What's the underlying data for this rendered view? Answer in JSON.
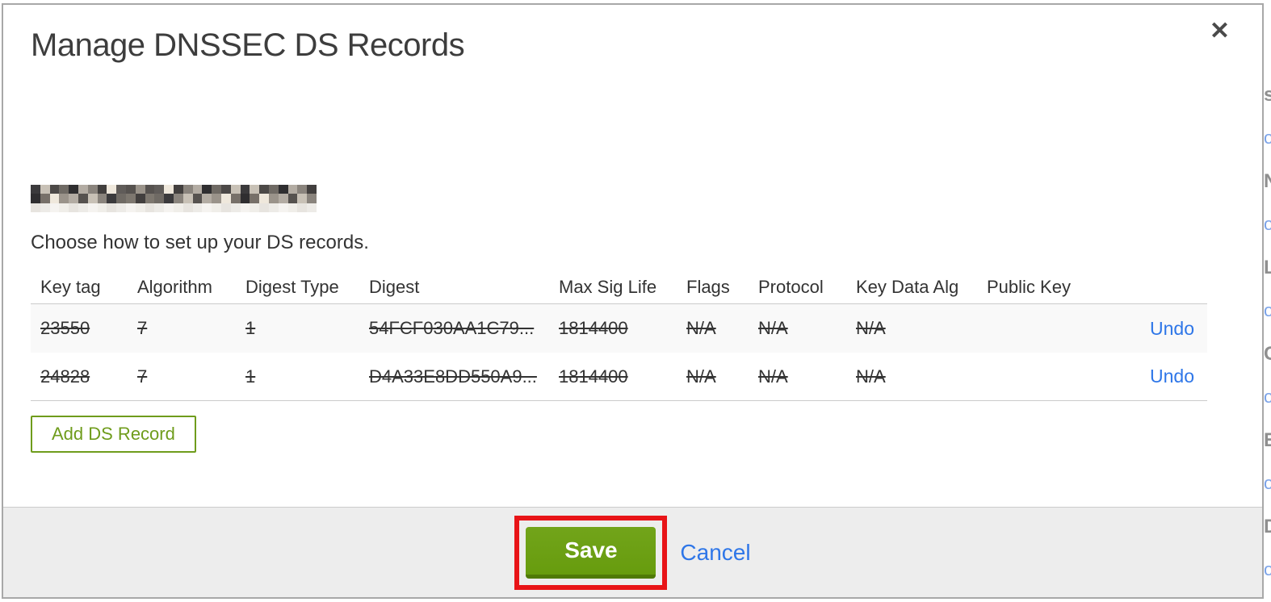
{
  "modal": {
    "title": "Manage DNSSEC DS Records",
    "close_icon": "✕",
    "domain": {
      "redacted": true
    },
    "subtitle": "Choose how to set up your DS records.",
    "table": {
      "headers": [
        "Key tag",
        "Algorithm",
        "Digest Type",
        "Digest",
        "Max Sig Life",
        "Flags",
        "Protocol",
        "Key Data Alg",
        "Public Key"
      ],
      "rows": [
        {
          "cells": [
            "23550",
            "7",
            "1",
            "54FCF030AA1C79...",
            "1814400",
            "N/A",
            "N/A",
            "N/A",
            ""
          ],
          "action": "Undo",
          "struck": true
        },
        {
          "cells": [
            "24828",
            "7",
            "1",
            "D4A33E8DD550A9...",
            "1814400",
            "N/A",
            "N/A",
            "N/A",
            ""
          ],
          "action": "Undo",
          "struck": true
        }
      ]
    },
    "add_record_button": "Add DS Record",
    "footer": {
      "save_button": "Save",
      "cancel_link": "Cancel"
    }
  },
  "annotation": {
    "highlight_color": "#e81417",
    "target": "save-button"
  },
  "colors": {
    "accent_green": "#689d0e",
    "outline_green": "#6f9c1c",
    "link_blue": "#2e76e8",
    "footer_bg": "#ededed",
    "row_alt_bg": "#f9f9f9",
    "border_gray": "#cccccc",
    "annotation_red": "#e81417"
  },
  "background_page_edge": {
    "fragments": [
      "s",
      "N",
      "L",
      "C",
      "E",
      "D"
    ]
  }
}
